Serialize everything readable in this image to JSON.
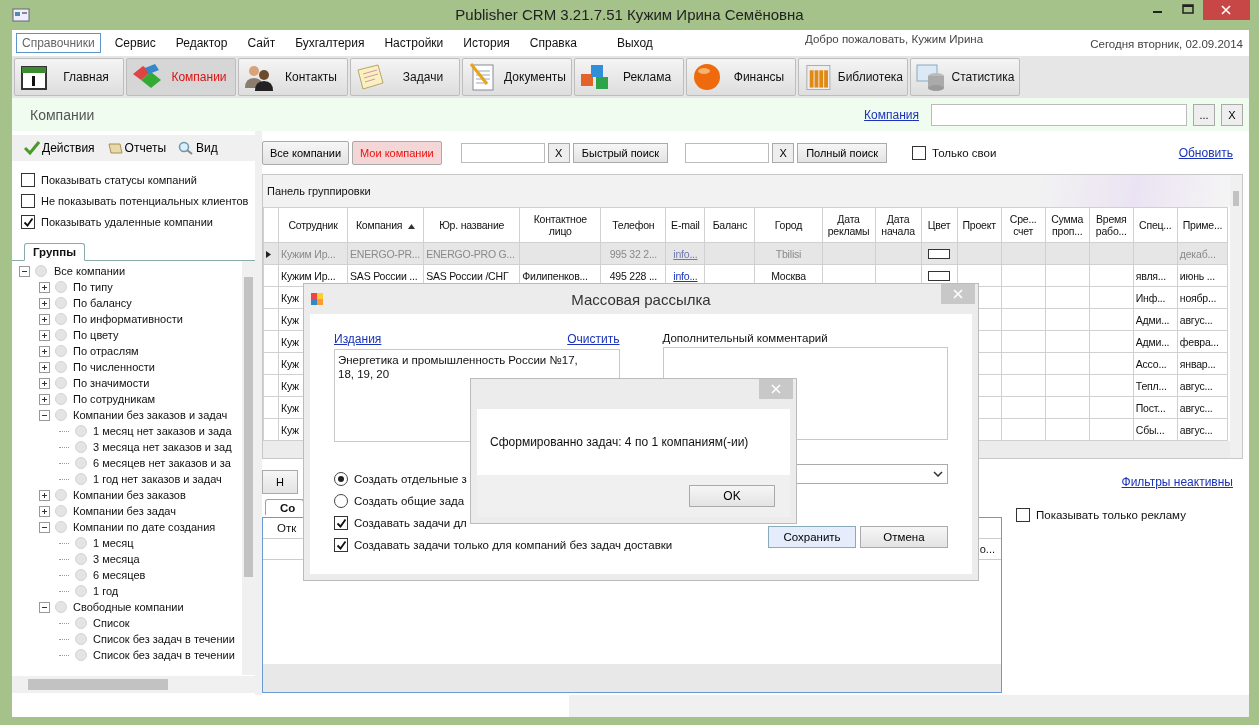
{
  "window": {
    "title": "Publisher CRM 3.21.7.51 Кужим Ирина Семёновна"
  },
  "menu": [
    {
      "label": "Справочники",
      "selected": true
    },
    {
      "label": "Сервис",
      "selected": false
    },
    {
      "label": "Редактор",
      "selected": false
    },
    {
      "label": "Сайт",
      "selected": false
    },
    {
      "label": "Бухгалтерия",
      "selected": false
    },
    {
      "label": "Настройки",
      "selected": false
    },
    {
      "label": "История",
      "selected": false
    },
    {
      "label": "Справка",
      "selected": false
    },
    {
      "label": "Выход",
      "selected": false
    }
  ],
  "welcome": "Добро пожаловать, Кужим Ирина",
  "date": "Сегодня вторник, 02.09.2014",
  "modules": [
    {
      "label": "Главная",
      "kind": "calendar",
      "selected": false
    },
    {
      "label": "Компании",
      "kind": "blocks",
      "selected": true
    },
    {
      "label": "Контакты",
      "kind": "people",
      "selected": false
    },
    {
      "label": "Задачи",
      "kind": "notes",
      "selected": false
    },
    {
      "label": "Документы",
      "kind": "document",
      "selected": false
    },
    {
      "label": "Реклама",
      "kind": "cubes",
      "selected": false
    },
    {
      "label": "Финансы",
      "kind": "sphere",
      "selected": false
    },
    {
      "label": "Библиотека",
      "kind": "books",
      "selected": false
    },
    {
      "label": "Статистика",
      "kind": "database",
      "selected": false
    }
  ],
  "page_title": "Компании",
  "company_filter": {
    "link": "Компания",
    "browse": "...",
    "clear": "X"
  },
  "left_toolbar": [
    {
      "label": "Действия",
      "kind": "check"
    },
    {
      "label": "Отчеты",
      "kind": "scroll"
    },
    {
      "label": "Вид",
      "kind": "magnifier"
    }
  ],
  "options": [
    {
      "label": "Показывать статусы компаний",
      "checked": false
    },
    {
      "label": "Не показывать потенциальных клиентов",
      "checked": false
    },
    {
      "label": "Показывать удаленные компании",
      "checked": true
    }
  ],
  "groups_tab": "Группы",
  "tree": [
    {
      "label": "Все компании",
      "expanded": true,
      "children": [
        {
          "label": "По типу",
          "expanded": false
        },
        {
          "label": "По балансу",
          "expanded": false
        },
        {
          "label": "По информативности",
          "expanded": false
        },
        {
          "label": "По цвету",
          "expanded": false
        },
        {
          "label": "По отраслям",
          "expanded": false
        },
        {
          "label": "По численности",
          "expanded": false
        },
        {
          "label": "По значимости",
          "expanded": false
        },
        {
          "label": "По сотрудникам",
          "expanded": false
        },
        {
          "label": "Компании без заказов и задач",
          "expanded": true,
          "children": [
            {
              "label": "1 месяц нет заказов и зада"
            },
            {
              "label": "3 месяца нет заказов и зад"
            },
            {
              "label": "6 месяцев нет заказов и за"
            },
            {
              "label": "1 год нет заказов и задач"
            }
          ]
        },
        {
          "label": "Компании без заказов",
          "expanded": false
        },
        {
          "label": "Компании без задач",
          "expanded": false
        },
        {
          "label": "Компании по дате создания",
          "expanded": true,
          "children": [
            {
              "label": "1 месяц"
            },
            {
              "label": "3 месяца"
            },
            {
              "label": "6 месяцев"
            },
            {
              "label": "1 год"
            }
          ]
        },
        {
          "label": "Свободные компании",
          "expanded": true,
          "children": [
            {
              "label": "Список"
            },
            {
              "label": "Список без задач в течении"
            },
            {
              "label": "Список без задач в течении"
            }
          ]
        }
      ]
    }
  ],
  "filters": [
    {
      "label": "Все компании",
      "selected": false
    },
    {
      "label": "Мои компании",
      "selected": true
    }
  ],
  "quick_search": {
    "clear": "X",
    "button": "Быстрый поиск"
  },
  "full_search": {
    "clear": "X",
    "button": "Полный поиск"
  },
  "only_mine": {
    "label": "Только свои",
    "checked": false
  },
  "refresh": "Обновить",
  "grouping_panel": "Панель группировки",
  "table": {
    "columns": [
      {
        "label": "Сотрудник",
        "sorted": false
      },
      {
        "label": "Компания",
        "sorted": true
      },
      {
        "label": "Юр. название",
        "sorted": false
      },
      {
        "label": "Контактное лицо",
        "sorted": false
      },
      {
        "label": "Телефон",
        "sorted": false
      },
      {
        "label": "E-mail",
        "sorted": false
      },
      {
        "label": "Баланс",
        "sorted": false
      },
      {
        "label": "Город",
        "sorted": false
      },
      {
        "label": "Дата рекламы",
        "sorted": false
      },
      {
        "label": "Дата начала",
        "sorted": false
      },
      {
        "label": "Цвет",
        "sorted": false
      },
      {
        "label": "Проект",
        "sorted": false
      },
      {
        "label": "Сре... счет",
        "sorted": false
      },
      {
        "label": "Сумма проп...",
        "sorted": false
      },
      {
        "label": "Время рабо...",
        "sorted": false
      },
      {
        "label": "Спец...",
        "sorted": false
      },
      {
        "label": "Приме...",
        "sorted": false
      }
    ],
    "rows": [
      {
        "selected": true,
        "deleted": true,
        "cells": [
          "Кужим Ир...",
          "ENERGO-PR...",
          "ENERGO-PRO G...",
          "",
          "995 32 2...",
          "info...",
          "",
          "Tbilisi",
          "",
          "",
          "",
          "",
          "",
          "",
          "",
          "",
          "декаб..."
        ],
        "color": "#ffffff"
      },
      {
        "selected": false,
        "deleted": false,
        "cells": [
          "Кужим Ир...",
          "SAS России ...",
          "SAS России /СНГ",
          "Филипенков...",
          "495 228 ...",
          "info...",
          "",
          "Москва",
          "",
          "",
          "",
          "",
          "",
          "",
          "",
          "явля...",
          "июнь ..."
        ],
        "color": "#ffffff"
      },
      {
        "selected": false,
        "deleted": false,
        "cells": [
          "Куж",
          "",
          "",
          "",
          "",
          "",
          "",
          "",
          "",
          "",
          "",
          "",
          "",
          "",
          "",
          "Инф...",
          "ноябр..."
        ]
      },
      {
        "selected": false,
        "deleted": false,
        "cells": [
          "Куж",
          "",
          "",
          "",
          "",
          "",
          "",
          "",
          "",
          "",
          "",
          "",
          "",
          "",
          "",
          "Адми...",
          "авгус..."
        ]
      },
      {
        "selected": false,
        "deleted": false,
        "cells": [
          "Куж",
          "",
          "",
          "",
          "",
          "",
          "",
          "",
          "",
          "",
          "",
          "",
          "",
          "",
          "",
          "Адми...",
          "февра..."
        ]
      },
      {
        "selected": false,
        "deleted": false,
        "cells": [
          "Куж",
          "",
          "",
          "",
          "",
          "",
          "",
          "",
          "",
          "",
          "",
          "",
          "",
          "",
          "",
          "Ассо...",
          "январ..."
        ]
      },
      {
        "selected": false,
        "deleted": false,
        "cells": [
          "Куж",
          "",
          "",
          "",
          "",
          "",
          "",
          "",
          "",
          "",
          "",
          "",
          "",
          "",
          "",
          "Тепл...",
          "авгус..."
        ]
      },
      {
        "selected": false,
        "deleted": false,
        "cells": [
          "Куж",
          "",
          "",
          "",
          "",
          "",
          "",
          "",
          "",
          "",
          "",
          "",
          "",
          "",
          "",
          "Пост...",
          "авгус..."
        ]
      },
      {
        "selected": false,
        "deleted": false,
        "cells": [
          "Куж",
          "",
          "",
          "",
          "",
          "",
          "",
          "",
          "",
          "",
          "",
          "",
          "",
          "",
          "",
          "Сбы...",
          "авгус..."
        ]
      }
    ]
  },
  "bottom": {
    "button": "Н",
    "filters_link": "Фильтры неактивны",
    "tab": "Со",
    "subtab": "Отк",
    "column": "о...",
    "only_ads": {
      "label": "Показывать только рекламу",
      "checked": false
    }
  },
  "dialog": {
    "title": "Массовая рассылка",
    "editions_link": "Издания",
    "clear_link": "Очистить",
    "editions": "Энергетика и промышленность России №17, 18, 19, 20",
    "comment_label": "Дополнительный комментарий",
    "options": [
      {
        "kind": "radio",
        "label": "Создать отдельные з",
        "selected": true
      },
      {
        "kind": "radio",
        "label": "Создать общие зада",
        "selected": false
      },
      {
        "kind": "checkbox",
        "label": "Создавать задачи дл",
        "checked": true
      },
      {
        "kind": "checkbox",
        "label": "Создавать задачи только для компаний без задач доставки",
        "checked": true
      }
    ],
    "buttons": [
      "Сохранить",
      "Отмена"
    ]
  },
  "message": {
    "text": "Сформированно задач: 4 по 1 компаниям(-ии)",
    "button": "OK"
  }
}
